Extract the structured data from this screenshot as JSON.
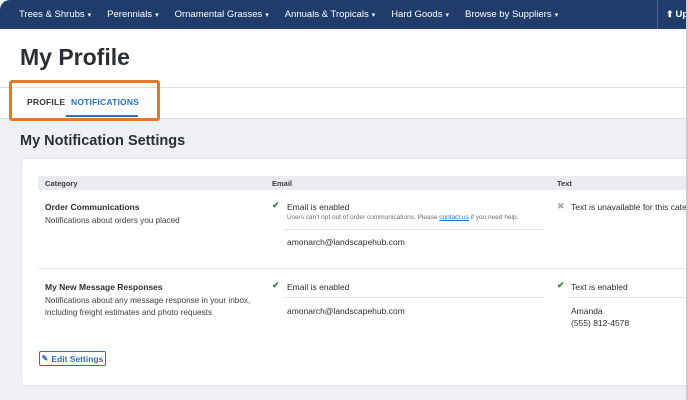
{
  "nav": {
    "items": [
      {
        "label": "Trees & Shrubs"
      },
      {
        "label": "Perennials"
      },
      {
        "label": "Ornamental Grasses"
      },
      {
        "label": "Annuals & Tropicals"
      },
      {
        "label": "Hard Goods"
      },
      {
        "label": "Browse by Suppliers"
      }
    ],
    "upload_label": "Up",
    "caret": "▾"
  },
  "page": {
    "title": "My Profile"
  },
  "tabs": {
    "profile": "PROFILE",
    "notifications": "NOTIFICATIONS",
    "active": "NOTIFICATIONS"
  },
  "settings": {
    "section_title": "My Notification Settings",
    "columns": {
      "category": "Category",
      "email": "Email",
      "text": "Text"
    },
    "rows": [
      {
        "title": "Order Communications",
        "description": "Notifications about orders you placed",
        "email_status": "Email is enabled",
        "email_note_pre": "Users can't opt out of order communications. Please ",
        "email_note_link": "contact us",
        "email_note_post": " if you need help.",
        "email_address": "amonarch@landscapehub.com",
        "text_status": "Text is unavailable for this category"
      },
      {
        "title": "My New Message Responses",
        "description_line1": "Notifications about any message response in your inbox,",
        "description_line2": "including freight estimates and photo requests",
        "email_status": "Email is enabled",
        "email_address": "amonarch@landscapehub.com",
        "text_status": "Text is enabled",
        "text_name": "Amanda",
        "text_phone": "(555) 812-4578"
      }
    ],
    "edit_button": "Edit Settings"
  },
  "icons": {
    "check": "✔",
    "x": "✖",
    "pencil": "✎",
    "upload": "⬆"
  },
  "colors": {
    "nav_bg": "#1f3c6b",
    "accent": "#2d6fc2",
    "highlight": "#e87722",
    "check": "#2e8b3e"
  }
}
